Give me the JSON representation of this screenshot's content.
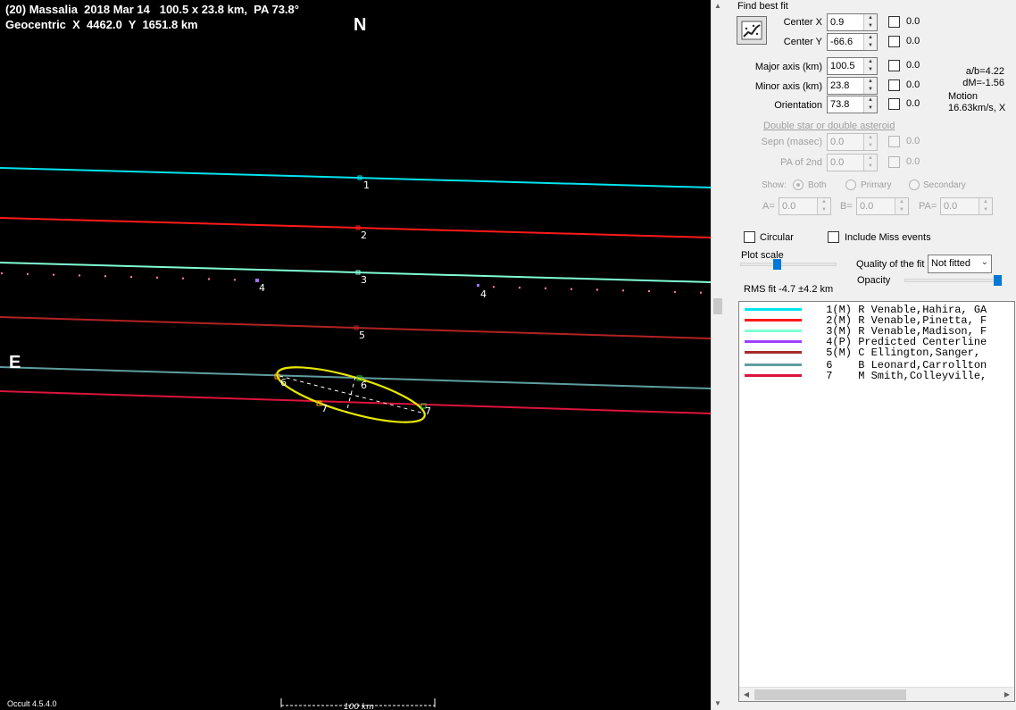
{
  "plot": {
    "header_line1": "(20) Massalia  2018 Mar 14   100.5 x 23.8 km,  PA 73.8°",
    "header_line2": "Geocentric  X  4462.0  Y  1651.8 km",
    "north_label": "N",
    "east_label": "E",
    "version": "Occult 4.5.4.0",
    "scale_label": "100 km",
    "background_color": "#000000",
    "ellipse_color": "#e6e600",
    "chords": [
      {
        "id": "1",
        "color": "#00e5ee",
        "label": "1"
      },
      {
        "id": "2",
        "color": "#ff1a1a",
        "label": "2"
      },
      {
        "id": "3",
        "color": "#7fffd4",
        "label": "3"
      },
      {
        "id": "4",
        "color": "#9f6fff",
        "label": "4"
      },
      {
        "id": "5",
        "color": "#b22222",
        "label": "5"
      },
      {
        "id": "6",
        "color": "#5f9ea0",
        "label": "6"
      },
      {
        "id": "7",
        "color": "#dc143c",
        "label": "7"
      }
    ]
  },
  "panel": {
    "find_best_fit": "Find best fit",
    "center_x_label": "Center X",
    "center_x_value": "0.9",
    "center_x_fit": "0.0",
    "center_y_label": "Center Y",
    "center_y_value": "-66.6",
    "center_y_fit": "0.0",
    "major_axis_label": "Major axis (km)",
    "major_axis_value": "100.5",
    "major_axis_fit": "0.0",
    "minor_axis_label": "Minor axis (km)",
    "minor_axis_value": "23.8",
    "minor_axis_fit": "0.0",
    "orientation_label": "Orientation",
    "orientation_value": "73.8",
    "orientation_fit": "0.0",
    "ratio_ab": "a/b=4.22",
    "dm": "dM=-1.56",
    "motion_label": "Motion",
    "motion_value": "16.63km/s, X",
    "double_star_link": "Double star  or  double asteroid",
    "sepn_label": "Sepn (masec)",
    "sepn_value": "0.0",
    "sepn_fit": "0.0",
    "pa2_label": "PA of 2nd",
    "pa2_value": "0.0",
    "pa2_fit": "0.0",
    "show_label": "Show:",
    "show_both": "Both",
    "show_primary": "Primary",
    "show_secondary": "Secondary",
    "a_label": "A=",
    "a_value": "0.0",
    "b_label": "B=",
    "b_value": "0.0",
    "pa_label": "PA=",
    "pa_value": "0.0",
    "circular_label": "Circular",
    "include_miss_label": "Include Miss events",
    "plot_scale_label": "Plot scale",
    "quality_label": "Quality of the fit",
    "quality_value": "Not fitted",
    "opacity_label": "Opacity",
    "rms_fit": "RMS fit -4.7 ±4.2 km"
  },
  "legend": [
    {
      "num": "1",
      "type": "(M)",
      "name": "R Venable,Hahira, GA",
      "color": "#00e5ee"
    },
    {
      "num": "2",
      "type": "(M)",
      "name": "R Venable,Pinetta, F",
      "color": "#ff1a1a"
    },
    {
      "num": "3",
      "type": "(M)",
      "name": "R Venable,Madison, F",
      "color": "#7fffd4"
    },
    {
      "num": "4",
      "type": "(P)",
      "name": "Predicted Centerline",
      "color": "#9f3fff"
    },
    {
      "num": "5",
      "type": "(M)",
      "name": "C Ellington,Sanger,",
      "color": "#a52a2a"
    },
    {
      "num": "6",
      "type": "",
      "name": "B Leonard,Carrollton",
      "color": "#5f9ea0"
    },
    {
      "num": "7",
      "type": "",
      "name": "M Smith,Colleyville,",
      "color": "#dc143c"
    }
  ]
}
